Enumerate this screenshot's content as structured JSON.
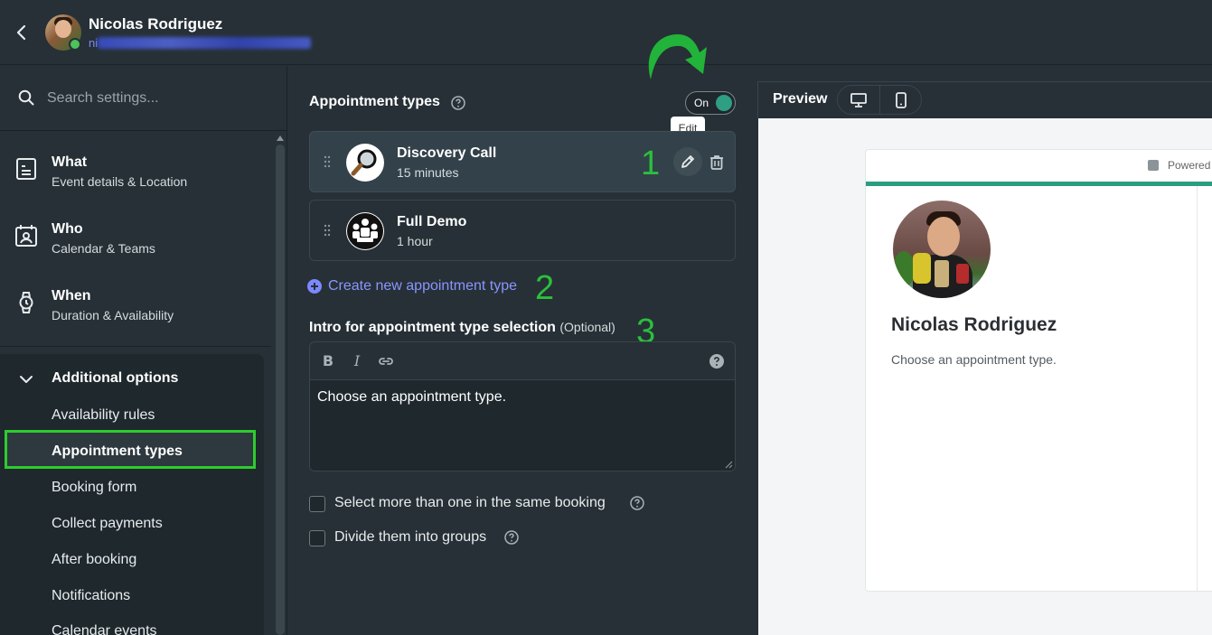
{
  "header": {
    "back_icon": "chevron-left-icon",
    "user_name": "Nicolas Rodriguez",
    "user_email_visible": "ni"
  },
  "sidebar": {
    "search_placeholder": "Search settings...",
    "items": [
      {
        "title": "What",
        "subtitle": "Event details & Location",
        "icon": "document-icon"
      },
      {
        "title": "Who",
        "subtitle": "Calendar & Teams",
        "icon": "calendar-person-icon"
      },
      {
        "title": "When",
        "subtitle": "Duration & Availability",
        "icon": "watch-icon"
      }
    ],
    "additional": {
      "title": "Additional options",
      "items": [
        "Availability rules",
        "Appointment types",
        "Booking form",
        "Collect payments",
        "After booking",
        "Notifications",
        "Calendar events"
      ],
      "active": "Appointment types"
    }
  },
  "main": {
    "section_title": "Appointment types",
    "toggle_label": "On",
    "tooltip": "Edit",
    "appointments": [
      {
        "name": "Discovery Call",
        "duration": "15 minutes",
        "icon": "magnifier-icon"
      },
      {
        "name": "Full Demo",
        "duration": "1 hour",
        "icon": "team-icon"
      }
    ],
    "create_link": "Create new appointment type",
    "intro_label": "Intro for appointment type selection",
    "intro_optional": "(Optional)",
    "intro_text": "Choose an appointment type.",
    "checkboxes": [
      {
        "label": "Select more than one in the same booking",
        "checked": false
      },
      {
        "label": "Divide them into groups",
        "checked": false
      }
    ],
    "annotations": [
      "1",
      "2",
      "3"
    ]
  },
  "preview": {
    "title": "Preview",
    "powered": "Powered",
    "name": "Nicolas Rodriguez",
    "intro": "Choose an appointment type."
  },
  "colors": {
    "background": "#263036",
    "accent_teal": "#2a9d82",
    "link": "#8a95ff",
    "annotation_green": "#2bbf3c"
  }
}
